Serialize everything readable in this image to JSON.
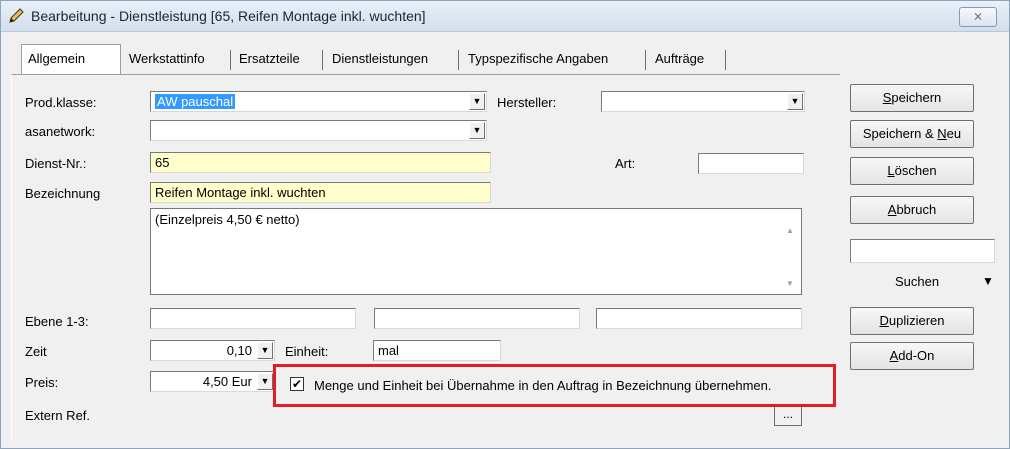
{
  "window": {
    "title": "Bearbeitung - Dienstleistung [65, Reifen Montage inkl. wuchten]",
    "close_label": "⨯"
  },
  "tabs": [
    {
      "label": "Allgemein"
    },
    {
      "label": "Werkstattinfo"
    },
    {
      "label": "Ersatzteile"
    },
    {
      "label": "Dienstleistungen"
    },
    {
      "label": "Typspezifische Angaben"
    },
    {
      "label": "Aufträge"
    }
  ],
  "form": {
    "prodklasse_label": "Prod.klasse:",
    "prodklasse_value": "AW pauschal",
    "hersteller_label": "Hersteller:",
    "hersteller_value": "",
    "asanetwork_label": "asanetwork:",
    "asanetwork_value": "",
    "dienstnr_label": "Dienst-Nr.:",
    "dienstnr_value": "65",
    "art_label": "Art:",
    "art_value": "",
    "bezeichnung_label": "Bezeichnung",
    "bezeichnung_value": "Reifen Montage inkl. wuchten",
    "memo_value": "(Einzelpreis 4,50 € netto)",
    "ebene_label": "Ebene 1-3:",
    "ebene_values": [
      "",
      "",
      ""
    ],
    "zeit_label": "Zeit",
    "zeit_value": "0,10",
    "einheit_label": "Einheit:",
    "einheit_value": "mal",
    "preis_label": "Preis:",
    "preis_value": "4,50 Eur",
    "checkbox_label": "Menge und Einheit bei Übernahme in den Auftrag in Bezeichnung übernehmen.",
    "checkbox_checked": true,
    "externref_label": "Extern Ref.",
    "ellipsis_label": "..."
  },
  "buttons": {
    "speichern_u": "S",
    "speichern_rest": "peichern",
    "speichernneu_pre": "Speichern & ",
    "speichernneu_u": "N",
    "speichernneu_rest": "eu",
    "loeschen_u": "L",
    "loeschen_rest": "öschen",
    "abbruch_u": "A",
    "abbruch_rest": "bbruch",
    "suchen_value": "",
    "suchen_label": "Suchen",
    "duplizieren_u": "D",
    "duplizieren_rest": "uplizieren",
    "addon_u": "A",
    "addon_rest": "dd-On"
  },
  "colors": {
    "highlight": "#e51c23",
    "required_field": "#ffffcc",
    "selection": "#3399ff"
  }
}
